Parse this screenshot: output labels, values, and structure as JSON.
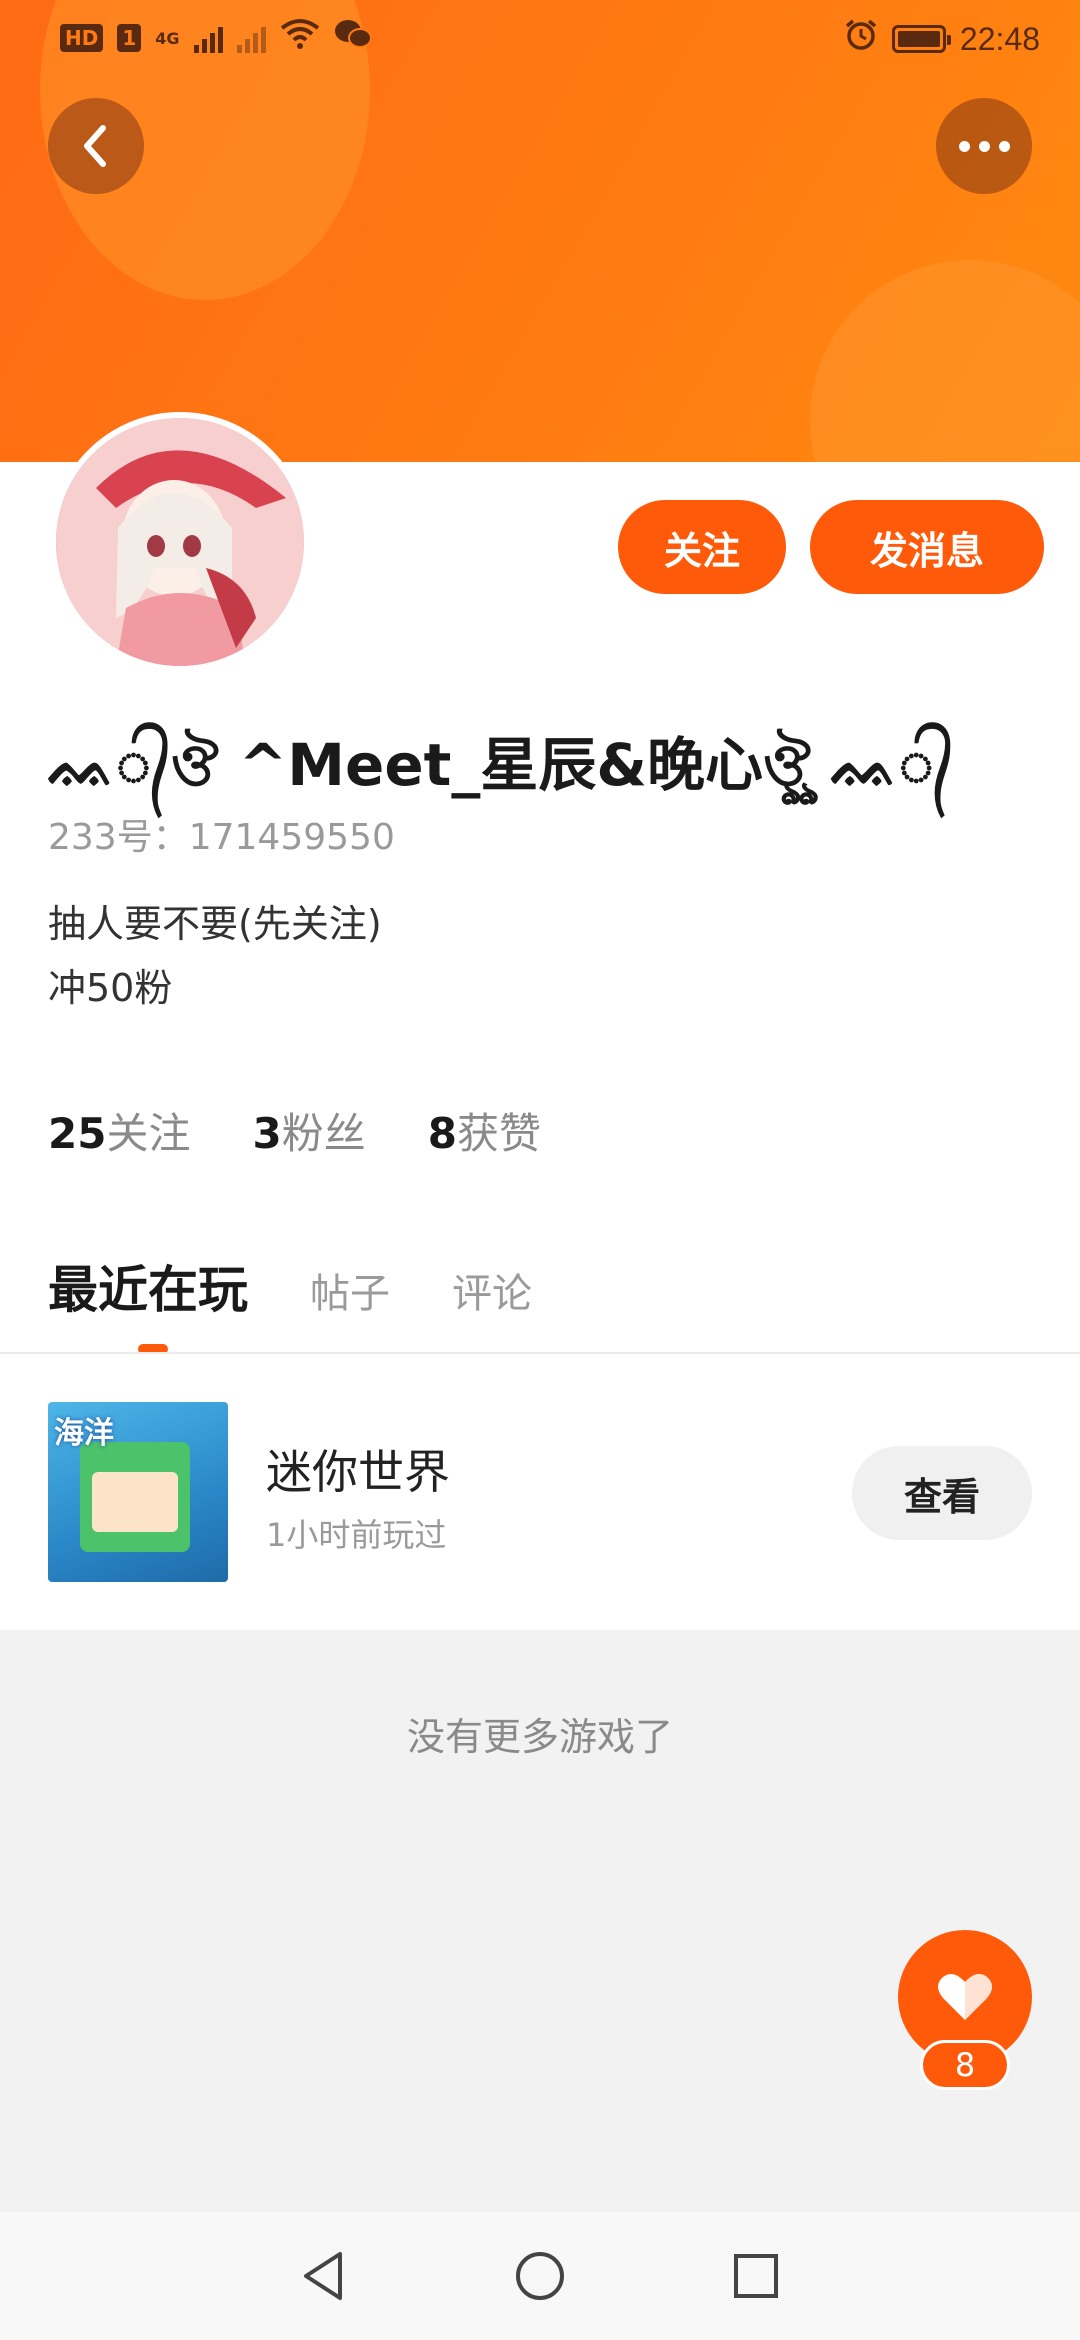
{
  "status_bar": {
    "hd_label": "HD",
    "sim_label": "1",
    "network_label": "4G",
    "time": "22:48"
  },
  "header": {
    "back_icon": "chevron-left-icon",
    "more_icon": "more-dots-icon"
  },
  "profile": {
    "nickname": "ᨐ᭄ঔ ^Meet_星辰&晚心ঔৣ ᨐ᭄",
    "user_id": "233号：171459550",
    "bio_lines": [
      "抽人要不要(先关注)",
      "冲50粉"
    ],
    "follow_label": "关注",
    "message_label": "发消息"
  },
  "stats": [
    {
      "value": "25",
      "label": "关注"
    },
    {
      "value": "3",
      "label": "粉丝"
    },
    {
      "value": "8",
      "label": "获赞"
    }
  ],
  "tabs": [
    {
      "label": "最近在玩",
      "active": true
    },
    {
      "label": "帖子",
      "active": false
    },
    {
      "label": "评论",
      "active": false
    }
  ],
  "games": [
    {
      "title": "迷你世界",
      "subtitle": "1小时前玩过",
      "thumb_tag": "海洋",
      "action_label": "查看"
    }
  ],
  "no_more_text": "没有更多游戏了",
  "like": {
    "count": "8",
    "icon": "heart-icon"
  },
  "colors": {
    "accent": "#ff5a0a",
    "banner": "#ff7a12"
  },
  "nav": {
    "back_icon": "triangle-back-icon",
    "home_icon": "circle-home-icon",
    "recents_icon": "square-recents-icon"
  }
}
